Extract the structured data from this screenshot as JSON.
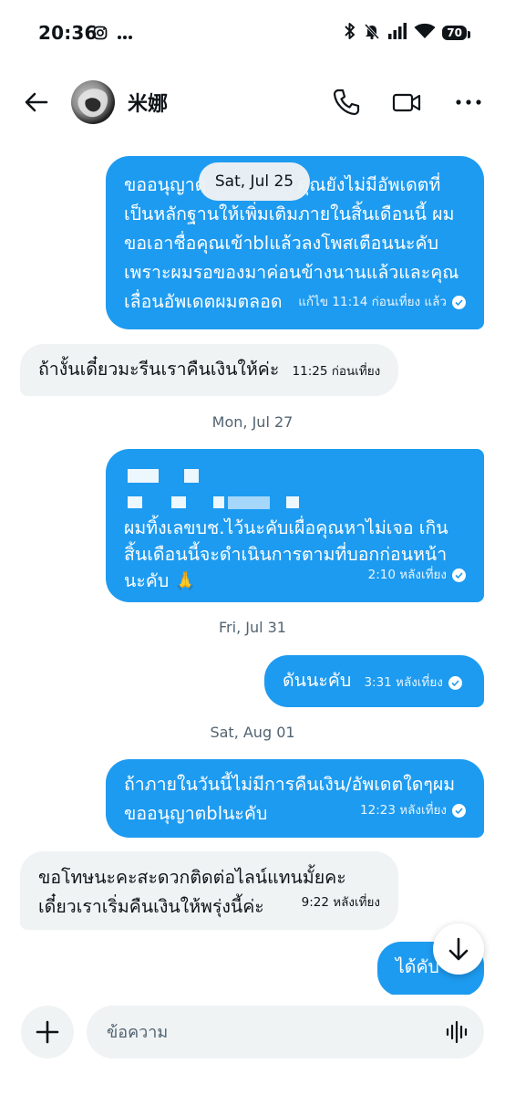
{
  "status_bar": {
    "time": "20:36",
    "battery": "70"
  },
  "header": {
    "contact_name": "米娜"
  },
  "floating_date": "Sat, Jul 25",
  "messages": [
    {
      "lines": [
        "ขออนุญาต",
        "เป็นหลักฐานให้เพิ่มเติมภายในสิ้นเดือนนี้ ผม",
        "ขอเอาชื่อคุณเข้าblแล้วลงโพสเตือนนะคับ",
        "เพราะผมรอของมาค่อนข้างนานแล้วและคุณ",
        "เลื่อนอัพเดตผมตลอด"
      ],
      "line1_tail": "คุณยังไม่มีอัพเดตที่",
      "meta": "แก้ไข 11:14 ก่อนเที่ยง แล้ว"
    },
    {
      "text": "ถ้างั้นเดี๋ยวมะรีนเราคืนเงินให้ค่ะ",
      "meta": "11:25 ก่อนเที่ยง"
    },
    {
      "lines": [
        "ผมทิ้งเลขบช.ไว้นะคับเผื่อคุณหาไม่เจอ เกิน",
        "สิ้นเดือนนี้จะดำเนินการตามที่บอกก่อนหน้า",
        "นะคับ 🙏"
      ],
      "meta": "2:10 หลังเที่ยง"
    },
    {
      "text": "ดันนะคับ",
      "meta": "3:31 หลังเที่ยง"
    },
    {
      "lines": [
        "ถ้าภายในวันนี้ไม่มีการคืนเงิน/อัพเดตใดๆผม",
        "ขออนุญาตblนะคับ"
      ],
      "meta": "12:23 หลังเที่ยง"
    },
    {
      "lines": [
        "ขอโทษนะคะสะดวกติดต่อไลน์แทนมั้ยคะ",
        "เดี๋ยวเราเริ่มคืนเงินให้พรุ่งนี้ค่ะ"
      ],
      "meta": "9:22 หลังเที่ยง"
    },
    {
      "text": "ได้คับ"
    }
  ],
  "dates": [
    "Mon, Jul 27",
    "Fri, Jul 31",
    "Sat, Aug 01"
  ],
  "composer": {
    "placeholder": "ข้อความ"
  },
  "colors": {
    "accent": "#1d9bf0",
    "incoming": "#eff3f4"
  }
}
